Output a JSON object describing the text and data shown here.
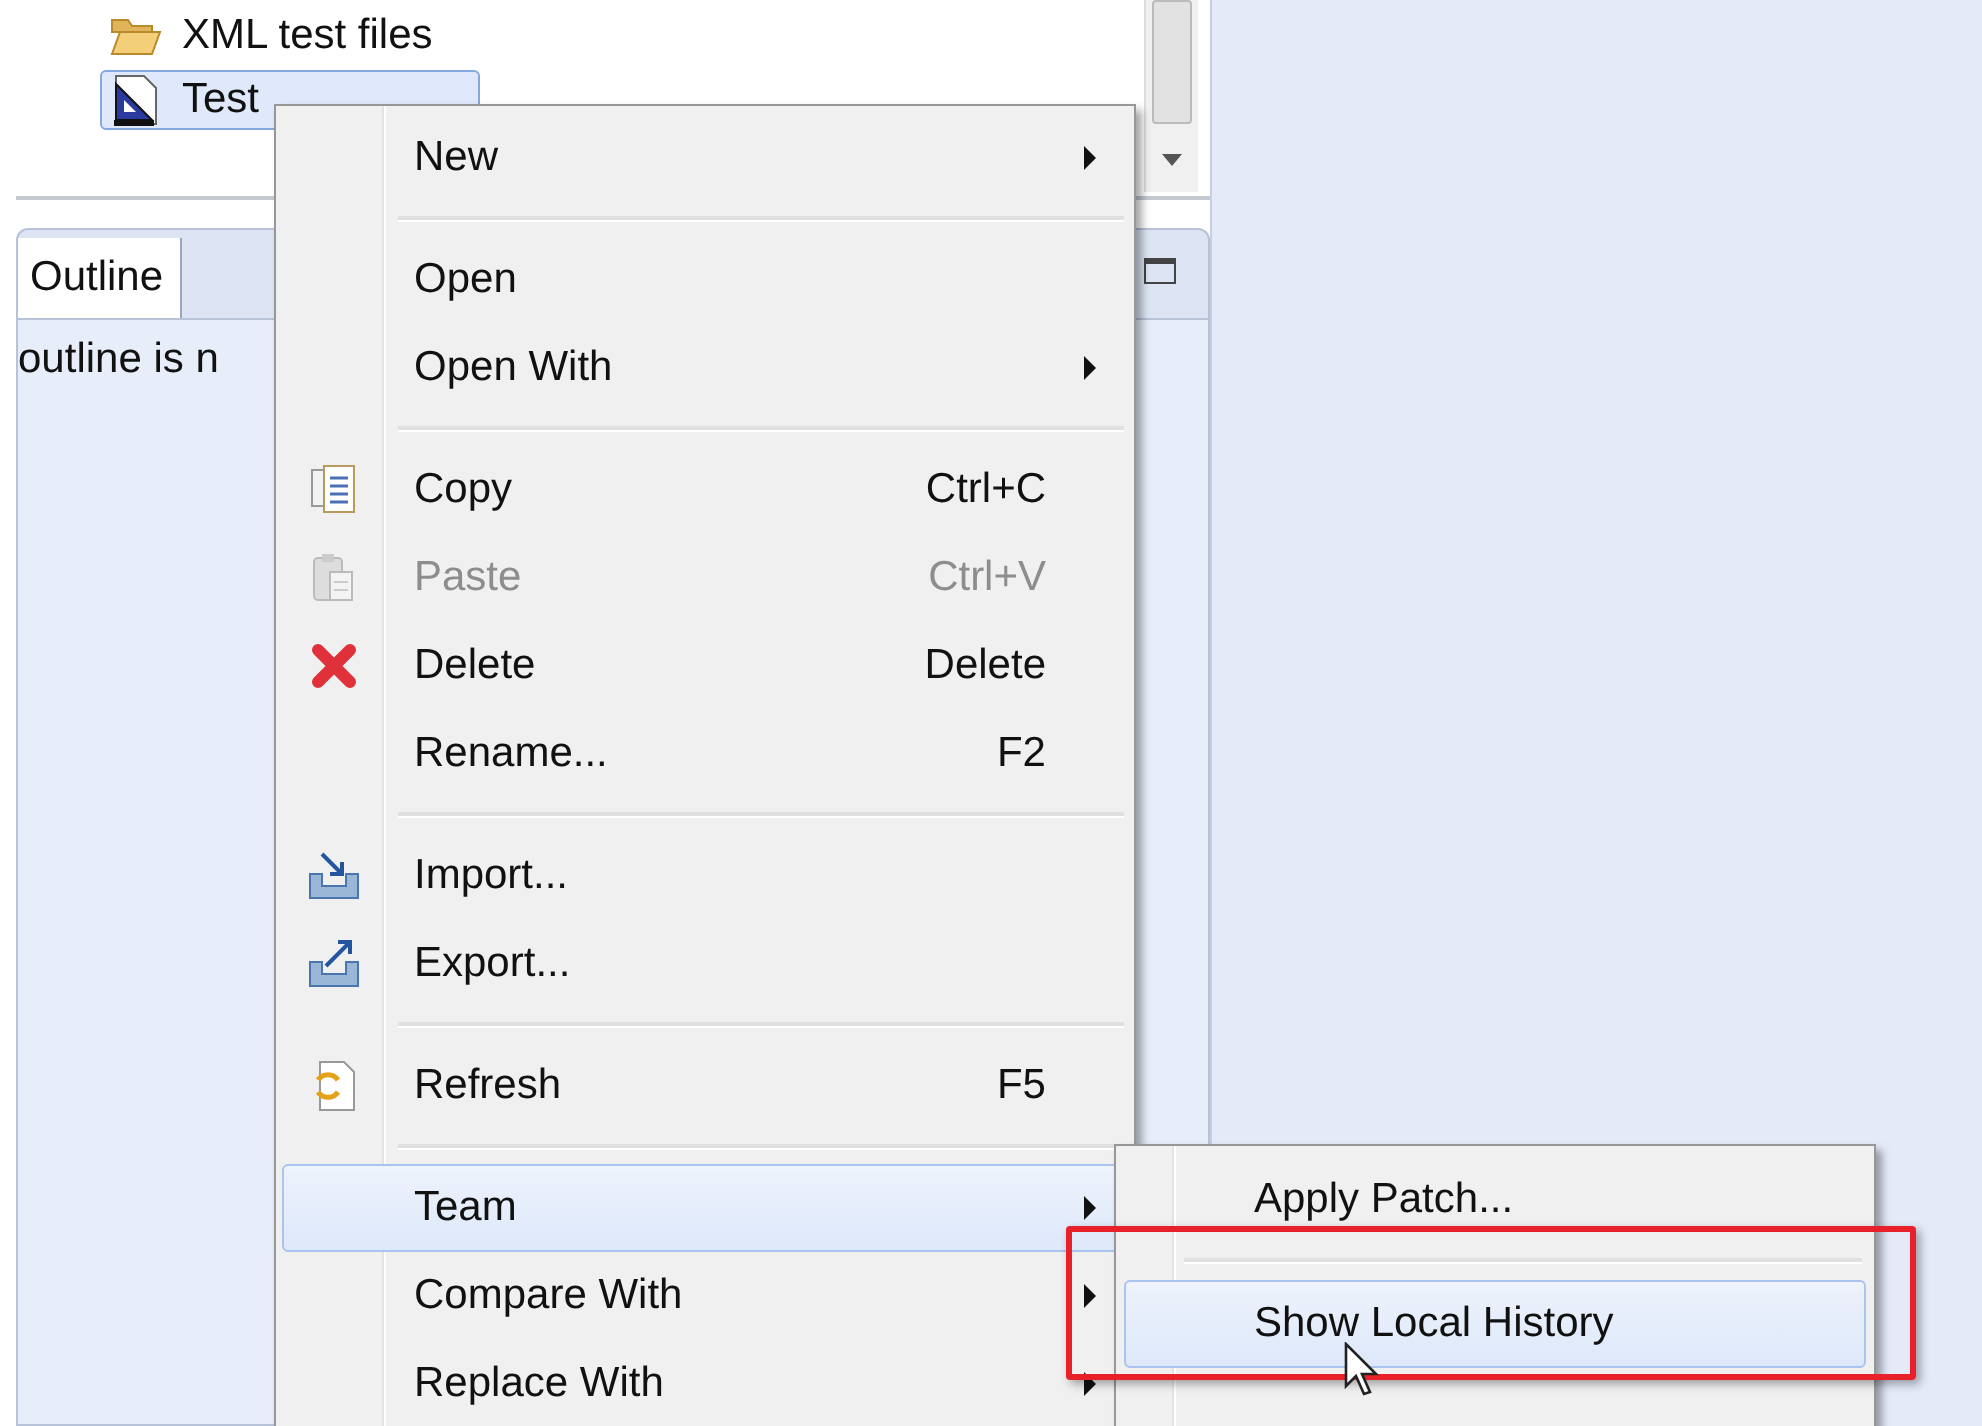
{
  "tree": {
    "items": [
      {
        "label": "XML test files",
        "kind": "folder",
        "selected": false
      },
      {
        "label": "Test",
        "kind": "project",
        "selected": true
      }
    ]
  },
  "outline": {
    "tab": {
      "label": "Outline",
      "selected": true
    },
    "message": "outline is n"
  },
  "context_menu": {
    "groups": [
      [
        {
          "label": "New",
          "kind": "plain",
          "has_submenu": true,
          "disabled": false,
          "selected": false
        }
      ],
      [
        {
          "label": "Open",
          "kind": "plain",
          "has_submenu": false,
          "disabled": false,
          "selected": false
        },
        {
          "label": "Open With",
          "kind": "plain",
          "has_submenu": true,
          "disabled": false,
          "selected": false
        }
      ],
      [
        {
          "label": "Copy",
          "kind": "copy",
          "shortcut": "Ctrl+C",
          "has_submenu": false,
          "disabled": false,
          "selected": false
        },
        {
          "label": "Paste",
          "kind": "paste",
          "shortcut": "Ctrl+V",
          "has_submenu": false,
          "disabled": true,
          "selected": false
        },
        {
          "label": "Delete",
          "kind": "delete",
          "shortcut": "Delete",
          "has_submenu": false,
          "disabled": false,
          "selected": false
        },
        {
          "label": "Rename...",
          "kind": "plain",
          "shortcut": "F2",
          "has_submenu": false,
          "disabled": false,
          "selected": false
        }
      ],
      [
        {
          "label": "Import...",
          "kind": "import",
          "has_submenu": false,
          "disabled": false,
          "selected": false
        },
        {
          "label": "Export...",
          "kind": "export",
          "has_submenu": false,
          "disabled": false,
          "selected": false
        }
      ],
      [
        {
          "label": "Refresh",
          "kind": "refresh",
          "shortcut": "F5",
          "has_submenu": false,
          "disabled": false,
          "selected": false
        }
      ],
      [
        {
          "label": "Team",
          "kind": "plain",
          "has_submenu": true,
          "disabled": false,
          "selected": true
        },
        {
          "label": "Compare With",
          "kind": "plain",
          "has_submenu": true,
          "disabled": false,
          "selected": false
        },
        {
          "label": "Replace With",
          "kind": "plain",
          "has_submenu": true,
          "disabled": false,
          "selected": false
        }
      ]
    ]
  },
  "submenu": {
    "groups": [
      [
        {
          "label": "Apply Patch...",
          "selected": false
        }
      ],
      [
        {
          "label": "Show Local History",
          "selected": true
        }
      ]
    ]
  }
}
